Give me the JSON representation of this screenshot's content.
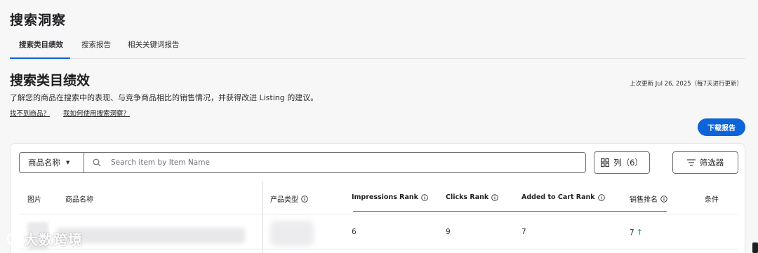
{
  "page_title": "搜索洞察",
  "tabs": [
    {
      "label": "搜索类目绩效",
      "active": true
    },
    {
      "label": "搜索报告",
      "active": false
    },
    {
      "label": "相关关键词报告",
      "active": false
    }
  ],
  "section": {
    "title": "搜索类目绩效",
    "last_updated": "上次更新 Jul 26, 2025（每7天进行更新）",
    "description": "了解您的商品在搜索中的表现、与竞争商品相比的销售情况，并获得改进 Listing 的建议。",
    "links": [
      "找不到商品？",
      "我如何使用搜索洞察？"
    ],
    "download_label": "下载报告"
  },
  "toolbar": {
    "category_label": "商品名称",
    "search_placeholder": "Search item by Item Name",
    "columns_label": "列（6）",
    "filter_label": "筛选器"
  },
  "table": {
    "headers": {
      "image": "图片",
      "name": "商品名称",
      "product_type": "产品类型",
      "impressions_rank": "Impressions Rank",
      "clicks_rank": "Clicks Rank",
      "added_to_cart_rank": "Added to Cart Rank",
      "sales_rank": "销售排名",
      "condition": "条件"
    },
    "rows": [
      {
        "impressions_rank": "6",
        "clicks_rank": "9",
        "added_to_cart_rank": "7",
        "sales_rank": "7",
        "sales_trend_arrow": "↑"
      }
    ]
  },
  "watermark": "大数跨境",
  "colors": {
    "accent": "#0d64d8",
    "sort_indicator": "#d24b3f",
    "trend_up": "#12a24b"
  }
}
